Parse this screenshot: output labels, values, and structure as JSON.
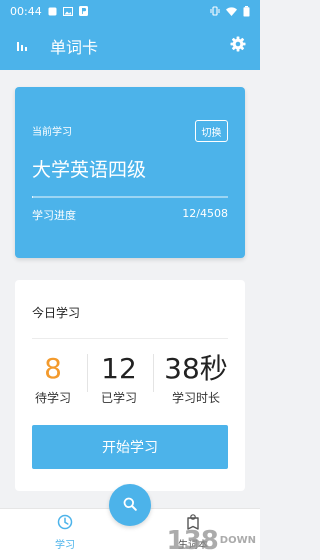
{
  "status_bar": {
    "time": "00:44",
    "left_icons": [
      "notification-square-icon",
      "image-icon",
      "p-app-icon"
    ],
    "right_icons": [
      "vibrate-icon",
      "wifi-icon",
      "battery-icon"
    ]
  },
  "app_bar": {
    "title": "单词卡",
    "left_icon": "bar-chart-icon",
    "right_icon": "gear-icon"
  },
  "course_card": {
    "label": "当前学习",
    "switch_label": "切换",
    "course_name": "大学英语四级",
    "progress_label": "学习进度",
    "progress_count": "12/4508",
    "progress_fraction": 0.0027
  },
  "today_card": {
    "title": "今日学习",
    "stats": [
      {
        "value": "8",
        "label": "待学习"
      },
      {
        "value": "12",
        "label": "已学习"
      },
      {
        "value": "38秒",
        "label": "学习时长"
      }
    ],
    "start_label": "开始学习"
  },
  "bottom_nav": {
    "items": [
      {
        "label": "学习",
        "icon": "clock-icon",
        "active": true
      },
      {
        "label": "生词本",
        "icon": "bookmark-book-icon",
        "active": false
      }
    ],
    "fab_icon": "search-icon"
  },
  "watermark": {
    "number": "138",
    "text": "DOWN"
  },
  "colors": {
    "primary": "#4cb3ea",
    "accent_orange": "#f39a2c",
    "background": "#f1f2f4"
  }
}
